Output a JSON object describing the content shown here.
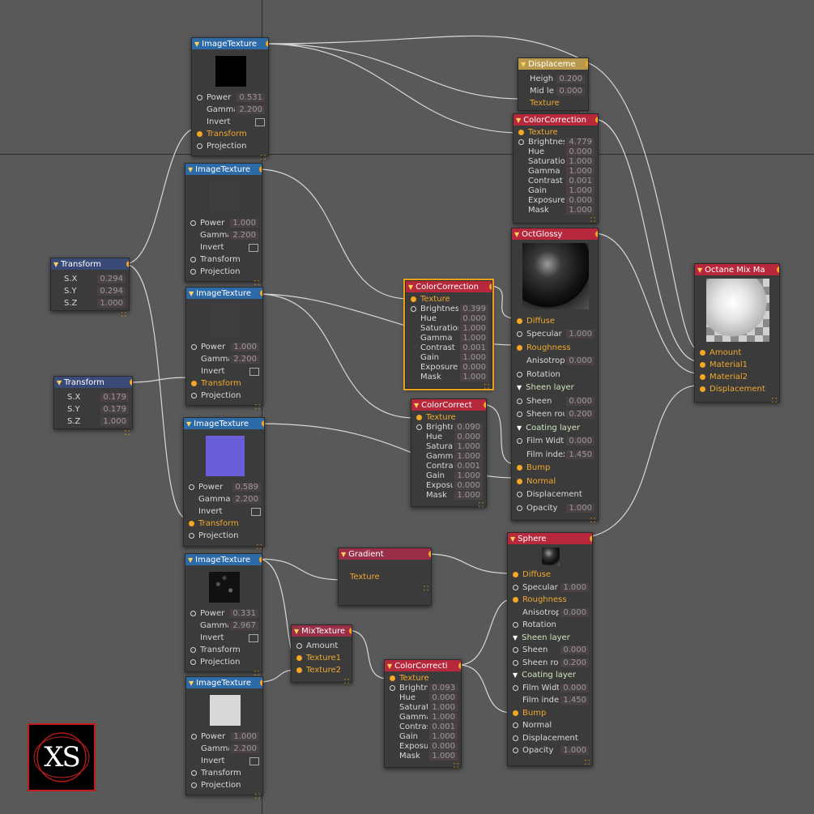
{
  "nodes": {
    "imgtex1": {
      "title": "ImageTexture",
      "power": "0.531",
      "gamma": "2.200",
      "invert": "Invert",
      "transform": "Transform",
      "projection": "Projection"
    },
    "imgtex2": {
      "title": "ImageTexture",
      "power": "1.000",
      "gamma": "2.200",
      "invert": "Invert",
      "transform": "Transform",
      "projection": "Projection"
    },
    "imgtex3": {
      "title": "ImageTexture",
      "power": "1.000",
      "gamma": "2.200",
      "invert": "Invert",
      "transform": "Transform",
      "projection": "Projection"
    },
    "imgtex4": {
      "title": "ImageTexture",
      "power": "0.589",
      "gamma": "2.200",
      "invert": "Invert",
      "transform": "Transform",
      "projection": "Projection"
    },
    "imgtex5": {
      "title": "ImageTexture",
      "power": "0.331",
      "gamma": "2.967",
      "invert": "Invert",
      "transform": "Transform",
      "projection": "Projection"
    },
    "imgtex6": {
      "title": "ImageTexture",
      "power": "1.000",
      "gamma": "2.200",
      "invert": "Invert",
      "transform": "Transform",
      "projection": "Projection"
    },
    "transform1": {
      "title": "Transform",
      "sx": "0.294",
      "sy": "0.294",
      "sz": "1.000"
    },
    "transform2": {
      "title": "Transform",
      "sx": "0.179",
      "sy": "0.179",
      "sz": "1.000"
    },
    "displace": {
      "title": "Displaceme",
      "height": "0.200",
      "midlevel": "0.000",
      "texture": "Texture"
    },
    "cc1": {
      "title": "ColorCorrection",
      "texture": "Texture",
      "brightness": "4.779",
      "hue": "0.000",
      "saturation": "1.000",
      "gamma": "1.000",
      "contrast": "0.001",
      "gain": "1.000",
      "exposure": "0.000",
      "mask": "1.000"
    },
    "cc2": {
      "title": "ColorCorrection",
      "texture": "Texture",
      "brightness": "0.399",
      "hue": "0.000",
      "saturation": "1.000",
      "gamma": "1.000",
      "contrast": "0.001",
      "gain": "1.000",
      "exposure": "0.000",
      "mask": "1.000"
    },
    "cc3": {
      "title": "ColorCorrect",
      "texture": "Texture",
      "brightness": "0.090",
      "hue": "0.000",
      "saturation": "1.000",
      "gamma": "1.000",
      "contrast": "0.001",
      "gain": "1.000",
      "exposure": "0.000",
      "mask": "1.000"
    },
    "cc4": {
      "title": "ColorCorrecti",
      "texture": "Texture",
      "brightness": "0.093",
      "hue": "0.000",
      "saturation": "1.000",
      "gamma": "1.000",
      "contrast": "0.001",
      "gain": "1.000",
      "exposure": "0.000",
      "mask": "1.000"
    },
    "glossy": {
      "title": "OctGlossy",
      "diffuse": "Diffuse",
      "specular": "1.000",
      "roughness": "Roughness",
      "aniso": "0.000",
      "rotation": "Rotation",
      "sheen_layer": "Sheen layer",
      "sheen": "0.000",
      "sheen_rough": "0.200",
      "coating": "Coating layer",
      "film_width": "0.000",
      "film_index": "1.450",
      "bump": "Bump",
      "normal": "Normal",
      "displacement": "Displacement",
      "opacity": "1.000"
    },
    "sphere": {
      "title": "Sphere",
      "diffuse": "Diffuse",
      "specular": "1.000",
      "roughness": "Roughness",
      "aniso": "0.000",
      "rotation": "Rotation",
      "sheen_layer": "Sheen layer",
      "sheen": "0.000",
      "sheen_rough": "0.200",
      "coating": "Coating layer",
      "film_width": "0.000",
      "film_index": "1.450",
      "bump": "Bump",
      "normal": "Normal",
      "displacement": "Displacement",
      "opacity": "1.000"
    },
    "mix": {
      "title": "Octane Mix Ma",
      "amount": "Amount",
      "material1": "Material1",
      "material2": "Material2",
      "displacement": "Displacement"
    },
    "gradient": {
      "title": "Gradient",
      "texture": "Texture"
    },
    "mixtex": {
      "title": "MixTexture",
      "amount": "Amount",
      "texture1": "Texture1",
      "texture2": "Texture2"
    }
  },
  "labels": {
    "power": "Power",
    "gamma": "Gamma",
    "hue": "Hue",
    "saturation": "Saturatio.",
    "brightness": "Brightnes.",
    "contrast": "Contrast",
    "gain": "Gain",
    "exposure": "Exposure",
    "mask": "Mask",
    "sx": "S.X",
    "sy": "S.Y",
    "sz": "S.Z",
    "height": "Heigh",
    "midlevel": "Mid le",
    "specular": "Specular",
    "aniso": "Anisotrop",
    "sheen": "Sheen",
    "sheen_rough": "Sheen rou",
    "film_width": "Film Widt",
    "film_index": "Film index",
    "opacity": "Opacity",
    "cc2_brightness": "Brightness",
    "cc2_saturation": "Saturation",
    "cc2_gamma": "Gamma",
    "cc3_brightness": "Brightn",
    "cc3_saturation": "Saturati",
    "cc3_gamma": "Gamma",
    "cc3_contrast": "Contra",
    "cc3_exposure": "Exposu",
    "cc4_brightness": "Brightn",
    "cc4_saturation": "Saturati",
    "cc4_contrast": "Contras",
    "cc4_exposure": "Exposur"
  },
  "logo": {
    "text": "XS"
  },
  "colors": {
    "wire": "#d8d8d8",
    "port": "#f5a623",
    "canvas": "#595959"
  }
}
